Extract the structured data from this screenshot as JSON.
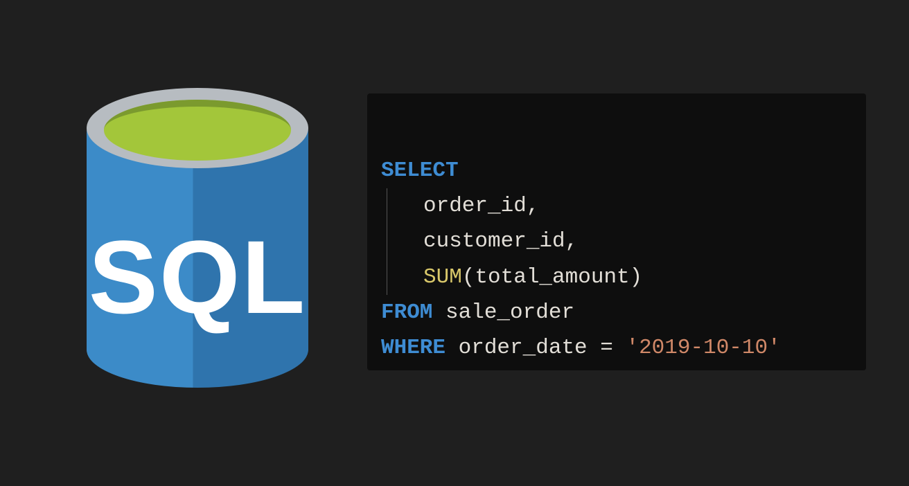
{
  "icon": {
    "label": "SQL"
  },
  "code": {
    "kw_select": "SELECT",
    "col1": "order_id,",
    "col2": "customer_id,",
    "func_sum": "SUM",
    "sum_arg": "(total_amount)",
    "kw_from": "FROM",
    "table": " sale_order",
    "kw_where": "WHERE",
    "where_col": " order_date = ",
    "date_literal": "'2019-10-10'"
  }
}
